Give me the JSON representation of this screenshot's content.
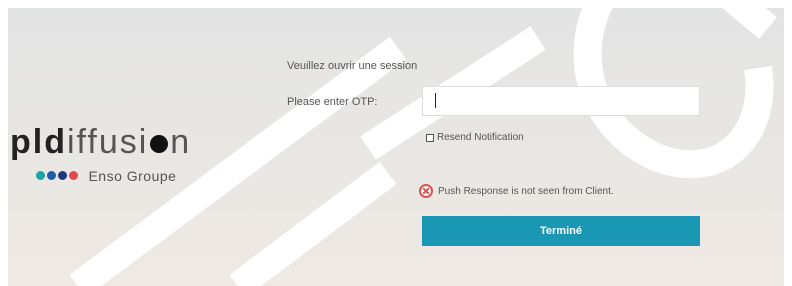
{
  "logo": {
    "part1": "pld",
    "part2": "iffusi",
    "part3": "n",
    "subtitle": "Enso Groupe",
    "dot_colors": [
      "#1aa6a6",
      "#1f5fa8",
      "#223a7a",
      "#e04b4b"
    ]
  },
  "form": {
    "title": "Veuillez ouvrir une session",
    "otp_label": "Please enter OTP:",
    "otp_value": "",
    "resend_label": "Resend Notification",
    "resend_checked": false,
    "error_message": "Push Response is not seen from Client.",
    "submit_label": "Terminé"
  },
  "colors": {
    "accent": "#1a97b3",
    "error": "#d9534f"
  },
  "icons": {
    "error": "error-circle-x-icon"
  }
}
